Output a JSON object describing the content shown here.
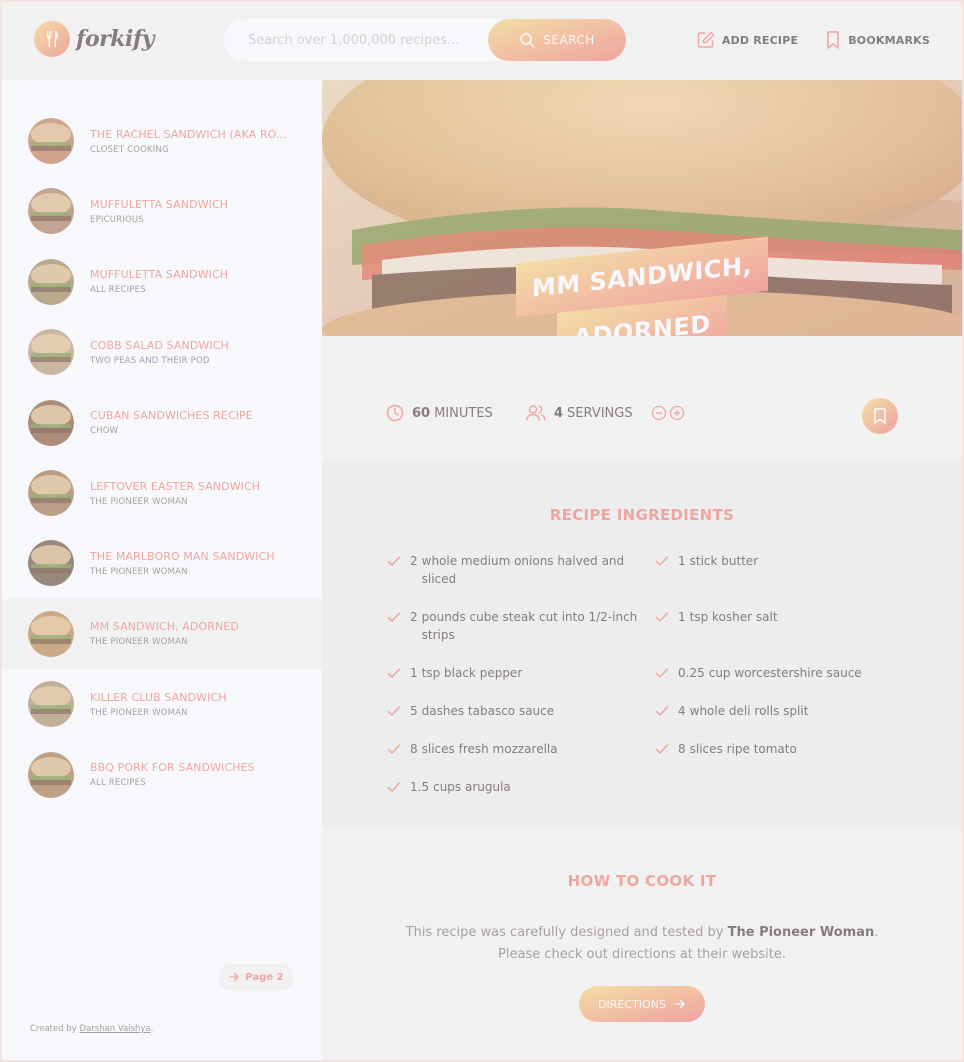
{
  "header": {
    "logo_text": "forkify",
    "search_placeholder": "Search over 1,000,000 recipes...",
    "search_button": "SEARCH",
    "nav": {
      "add_recipe": "ADD RECIPE",
      "bookmarks": "BOOKMARKS"
    }
  },
  "sidebar": {
    "results": [
      {
        "title": "THE RACHEL SANDWICH (AKA RO...",
        "publisher": "CLOSET COOKING",
        "thumb_color": "#c98a6a"
      },
      {
        "title": "MUFFULETTA SANDWICH",
        "publisher": "EPICURIOUS",
        "thumb_color": "#b88a6e"
      },
      {
        "title": "MUFFULETTA SANDWICH",
        "publisher": "ALL RECIPES",
        "thumb_color": "#a99468"
      },
      {
        "title": "COBB SALAD SANDWICH",
        "publisher": "TWO PEAS AND THEIR POD",
        "thumb_color": "#c3a487"
      },
      {
        "title": "CUBAN SANDWICHES RECIPE",
        "publisher": "CHOW",
        "thumb_color": "#9a6a4e"
      },
      {
        "title": "LEFTOVER EASTER SANDWICH",
        "publisher": "THE PIONEER WOMAN",
        "thumb_color": "#a9825a"
      },
      {
        "title": "THE MARLBORO MAN SANDWICH",
        "publisher": "THE PIONEER WOMAN",
        "thumb_color": "#7a6452"
      },
      {
        "title": "MM SANDWICH, ADORNED",
        "publisher": "THE PIONEER WOMAN",
        "thumb_color": "#c29462"
      },
      {
        "title": "KILLER CLUB SANDWICH",
        "publisher": "THE PIONEER WOMAN",
        "thumb_color": "#b59a7a"
      },
      {
        "title": "BBQ PORK FOR SANDWICHES",
        "publisher": "ALL RECIPES",
        "thumb_color": "#b0855c"
      }
    ],
    "active_index": 7,
    "page_button": "Page 2",
    "copyright_prefix": "Created by",
    "copyright_author": "Darshan Vaishya",
    "copyright_suffix": "."
  },
  "recipe": {
    "title_line1": "MM SANDWICH,",
    "title_line2": "ADORNED",
    "cooking_time": "60",
    "cooking_time_unit": "MINUTES",
    "servings": "4",
    "servings_unit": "SERVINGS",
    "ingredients_heading": "RECIPE INGREDIENTS",
    "ingredients": [
      {
        "qty": "2",
        "desc": "whole medium onions halved and sliced"
      },
      {
        "qty": "1",
        "desc": "stick butter"
      },
      {
        "qty": "2",
        "desc": "pounds cube steak cut into 1/2-inch strips"
      },
      {
        "qty": "1",
        "desc": "tsp kosher salt"
      },
      {
        "qty": "1",
        "desc": "tsp black pepper"
      },
      {
        "qty": "0.25",
        "desc": "cup worcestershire sauce"
      },
      {
        "qty": "5",
        "desc": "dashes tabasco sauce"
      },
      {
        "qty": "4",
        "desc": "whole deli rolls split"
      },
      {
        "qty": "8",
        "desc": "slices fresh mozzarella"
      },
      {
        "qty": "8",
        "desc": "slices ripe tomato"
      },
      {
        "qty": "1.5",
        "desc": "cups arugula"
      }
    ],
    "directions_heading": "HOW TO COOK IT",
    "directions_text_prefix": "This recipe was carefully designed and tested by ",
    "directions_publisher": "The Pioneer Woman",
    "directions_text_suffix": ". Please check out directions at their website.",
    "directions_button": "DIRECTIONS"
  },
  "colors": {
    "accent": "#f38e82",
    "gradient_start": "#fbdb89",
    "gradient_end": "#f48982",
    "text": "#615551"
  },
  "icons": {
    "search": "search-icon",
    "add_recipe": "edit-icon",
    "bookmarks": "bookmark-icon",
    "time": "clock-icon",
    "servings": "users-icon",
    "check": "check-icon",
    "arrow": "arrow-right-icon"
  }
}
